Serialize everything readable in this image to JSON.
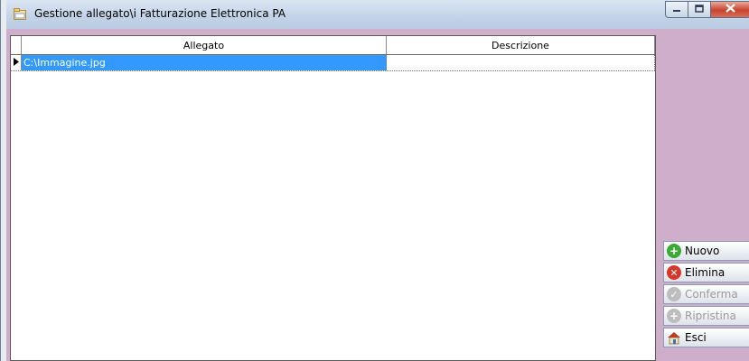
{
  "window": {
    "title": "Gestione allegato\\i Fatturazione Elettronica PA",
    "controls": {
      "minimize": "minimize-icon",
      "maximize": "maximize-icon",
      "close": "close-icon"
    }
  },
  "grid": {
    "columns": [
      "Allegato",
      "Descrizione"
    ],
    "rows": [
      {
        "allegato": "C:\\Immagine.jpg",
        "descrizione": "",
        "selected": true
      }
    ]
  },
  "buttons": {
    "nuovo": "Nuovo",
    "elimina": "Elimina",
    "conferma": "Conferma",
    "ripristina": "Ripristina",
    "esci": "Esci"
  },
  "colors": {
    "selection": "#3399ff",
    "client_background": "#cfaecb",
    "add": "#3aa935",
    "delete": "#d9362b",
    "disabled": "#bdbdbd"
  }
}
